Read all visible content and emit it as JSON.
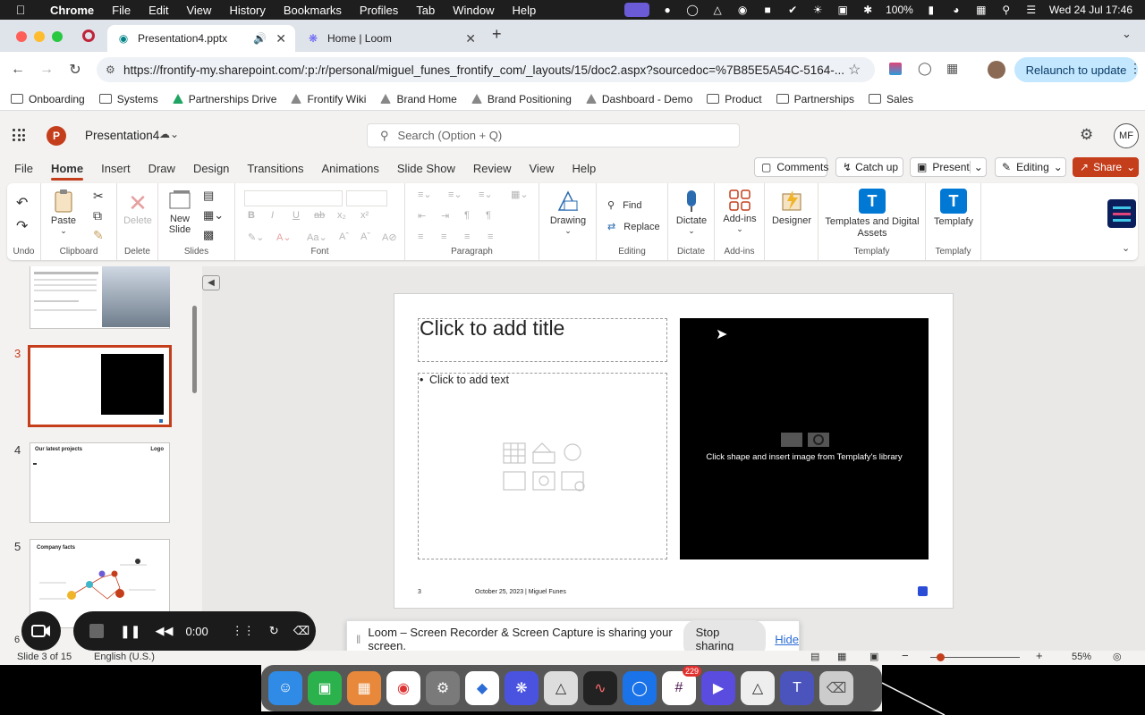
{
  "menubar": {
    "app": "Chrome",
    "items": [
      "File",
      "Edit",
      "View",
      "History",
      "Bookmarks",
      "Profiles",
      "Tab",
      "Window",
      "Help"
    ],
    "battery": "100%",
    "datetime": "Wed 24 Jul  17:46"
  },
  "tabs": [
    {
      "title": "Presentation4.pptx"
    },
    {
      "title": "Home | Loom"
    }
  ],
  "address": {
    "url": "https://frontify-my.sharepoint.com/:p:/r/personal/miguel_funes_frontify_com/_layouts/15/doc2.aspx?sourcedoc=%7B85E5A54C-5164-...",
    "relaunch_label": "Relaunch to update"
  },
  "bookmarks": [
    "Onboarding",
    "Systems",
    "Partnerships Drive",
    "Frontify Wiki",
    "Brand Home",
    "Brand Positioning",
    "Dashboard - Demo",
    "Product",
    "Partnerships",
    "Sales"
  ],
  "app": {
    "doc_title": "Presentation4",
    "search_placeholder": "Search (Option + Q)",
    "avatar_initials": "MF"
  },
  "ribbon_tabs": [
    "File",
    "Home",
    "Insert",
    "Draw",
    "Design",
    "Transitions",
    "Animations",
    "Slide Show",
    "Review",
    "View",
    "Help"
  ],
  "header_buttons": {
    "comments": "Comments",
    "catchup": "Catch up",
    "present": "Present",
    "editing": "Editing",
    "share": "Share"
  },
  "ribbon": {
    "undo_group": "Undo",
    "paste": "Paste",
    "clipboard_group": "Clipboard",
    "delete": "Delete",
    "delete_group": "Delete",
    "new_slide": "New Slide",
    "slides_group": "Slides",
    "font_group": "Font",
    "paragraph_group": "Paragraph",
    "drawing": "Drawing",
    "find": "Find",
    "replace": "Replace",
    "editing_group": "Editing",
    "dictate": "Dictate",
    "dictate_group": "Dictate",
    "addins": "Add-ins",
    "addins_group": "Add-ins",
    "designer": "Designer",
    "templates": "Templates and Digital Assets",
    "templafy_group": "Templafy",
    "templafy": "Templafy",
    "templafy_group2": "Templafy"
  },
  "thumbnails": [
    {
      "number": "3"
    },
    {
      "number": "4",
      "title": "Our latest projects",
      "logo": "Logo"
    },
    {
      "number": "5",
      "title": "Company facts"
    },
    {
      "number": "6"
    }
  ],
  "slide": {
    "title_placeholder": "Click to add title",
    "text_placeholder": "Click to add text",
    "image_hint": "Click shape and insert image from Templafy's library",
    "footer_number": "3",
    "footer_date": "October 25, 2023 | Miguel Funes"
  },
  "loom": {
    "timer": "0:00",
    "sharing_text": "Loom – Screen Recorder & Screen Capture is sharing your screen.",
    "stop_label": "Stop sharing",
    "hide_label": "Hide"
  },
  "status": {
    "slide_info": "Slide 3 of 15",
    "language": "English (U.S.)",
    "zoom": "55%"
  },
  "dock": {
    "slack_badge": "229"
  },
  "colors": {
    "accent": "#c43e1c",
    "selected_thumb": "#c43e1c",
    "templafy": "#0078d4"
  }
}
